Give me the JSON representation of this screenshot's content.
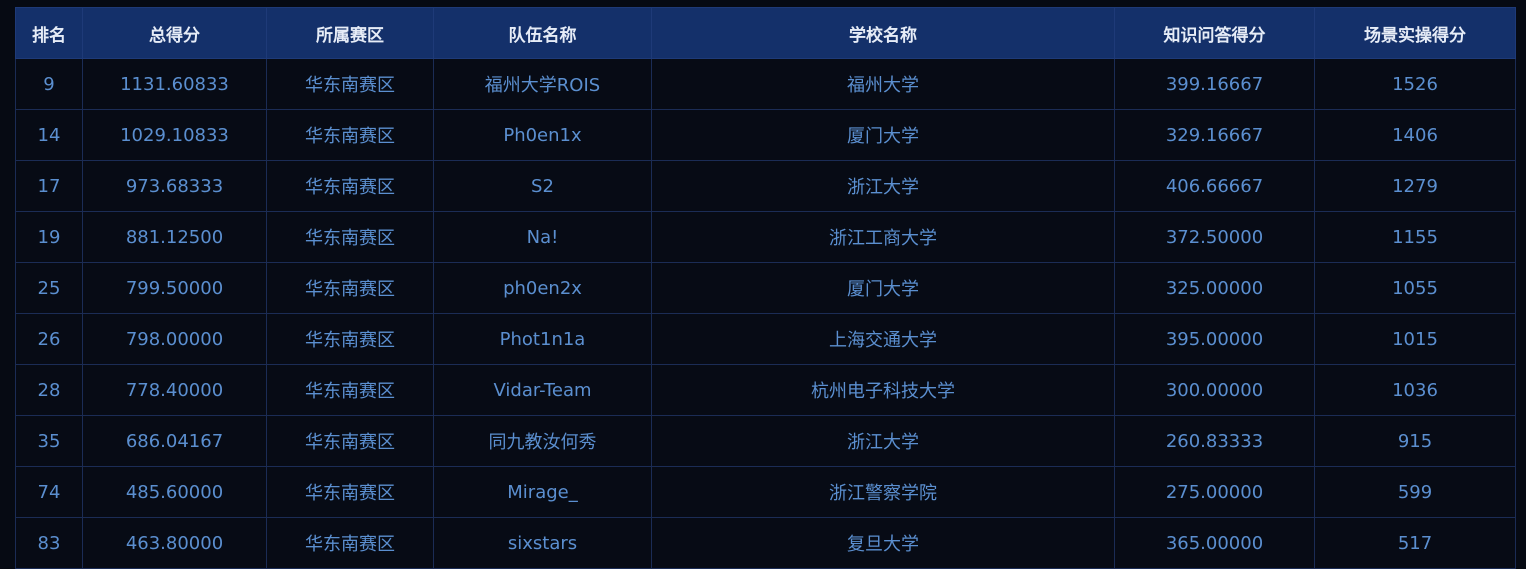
{
  "table": {
    "headers": [
      "排名",
      "总得分",
      "所属赛区",
      "队伍名称",
      "学校名称",
      "知识问答得分",
      "场景实操得分"
    ],
    "rows": [
      [
        "9",
        "1131.60833",
        "华东南赛区",
        "福州大学ROIS",
        "福州大学",
        "399.16667",
        "1526"
      ],
      [
        "14",
        "1029.10833",
        "华东南赛区",
        "Ph0en1x",
        "厦门大学",
        "329.16667",
        "1406"
      ],
      [
        "17",
        "973.68333",
        "华东南赛区",
        "S2",
        "浙江大学",
        "406.66667",
        "1279"
      ],
      [
        "19",
        "881.12500",
        "华东南赛区",
        "Na!",
        "浙江工商大学",
        "372.50000",
        "1155"
      ],
      [
        "25",
        "799.50000",
        "华东南赛区",
        "ph0en2x",
        "厦门大学",
        "325.00000",
        "1055"
      ],
      [
        "26",
        "798.00000",
        "华东南赛区",
        "Phot1n1a",
        "上海交通大学",
        "395.00000",
        "1015"
      ],
      [
        "28",
        "778.40000",
        "华东南赛区",
        "Vidar-Team",
        "杭州电子科技大学",
        "300.00000",
        "1036"
      ],
      [
        "35",
        "686.04167",
        "华东南赛区",
        "同九教汝何秀",
        "浙江大学",
        "260.83333",
        "915"
      ],
      [
        "74",
        "485.60000",
        "华东南赛区",
        "Mirage_",
        "浙江警察学院",
        "275.00000",
        "599"
      ],
      [
        "83",
        "463.80000",
        "华东南赛区",
        "sixstars",
        "复旦大学",
        "365.00000",
        "517"
      ]
    ]
  }
}
